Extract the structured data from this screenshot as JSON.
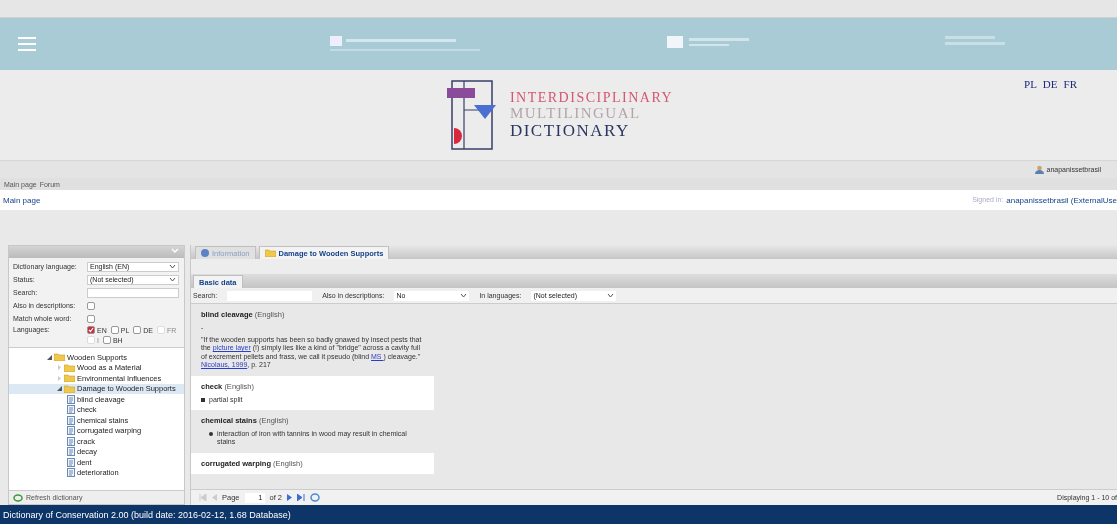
{
  "header": {
    "languages": [
      "PL",
      "DE",
      "FR"
    ],
    "logo_lines": [
      "INTERDISCIPLINARY",
      "MULTILINGUAL",
      "DICTIONARY"
    ],
    "user": "anapanissetbrasil"
  },
  "nav": [
    "Main page",
    "Forum"
  ],
  "breadcrumb": {
    "title": "Main page",
    "signed_label": "Signed in:",
    "signed_user": "anapanissetbrasil (ExternalUse"
  },
  "sidebar": {
    "fields": [
      {
        "kind": "select",
        "label": "Dictionary language:",
        "value": "English (EN)"
      },
      {
        "kind": "select",
        "label": "Status:",
        "value": "(Not selected)"
      },
      {
        "kind": "text",
        "label": "Search:"
      },
      {
        "kind": "checkbox",
        "label": "Also in descriptions:",
        "checked": false
      },
      {
        "kind": "checkbox",
        "label": "Match whole word:",
        "checked": false
      }
    ],
    "languages_label": "Languages:",
    "languages": [
      {
        "label": "EN",
        "checked": true,
        "disabled": false
      },
      {
        "label": "PL",
        "checked": false,
        "disabled": false
      },
      {
        "label": "DE",
        "checked": false,
        "disabled": false
      },
      {
        "label": "FR",
        "checked": false,
        "disabled": true
      },
      {
        "label": "I",
        "checked": false,
        "disabled": true
      },
      {
        "label": "BH",
        "checked": false,
        "disabled": false
      }
    ],
    "tree": [
      {
        "label": "Wooden Supports",
        "kind": "folder",
        "expanded": true,
        "selected": false,
        "children": [
          {
            "label": "Wood as a Material",
            "kind": "folder",
            "expanded": false,
            "selected": false
          },
          {
            "label": "Environmental Influences",
            "kind": "folder",
            "expanded": false,
            "selected": false
          },
          {
            "label": "Damage to Wooden Supports",
            "kind": "folder",
            "expanded": true,
            "selected": true,
            "children": [
              {
                "label": "blind cleavage",
                "kind": "term",
                "selected": false
              },
              {
                "label": "check",
                "kind": "term",
                "selected": false
              },
              {
                "label": "chemical stains",
                "kind": "term",
                "selected": false
              },
              {
                "label": "corrugated warping",
                "kind": "term",
                "selected": false
              },
              {
                "label": "crack",
                "kind": "term",
                "selected": false
              },
              {
                "label": "decay",
                "kind": "term",
                "selected": false
              },
              {
                "label": "dent",
                "kind": "term",
                "selected": false
              },
              {
                "label": "deterioration",
                "kind": "term",
                "selected": false
              }
            ]
          }
        ]
      }
    ],
    "refresh": "Refresh dictionary"
  },
  "tabs": [
    {
      "label": "Information",
      "kind": "info",
      "selected": false
    },
    {
      "label": "Damage to Wooden Supports",
      "kind": "folder",
      "selected": true
    }
  ],
  "subtabs": [
    {
      "label": "Basic data",
      "selected": true
    }
  ],
  "filters": {
    "search_label": "Search:",
    "desc_label": "Also in descriptions:",
    "desc_value": "No",
    "lang_label": "In languages:",
    "lang_value": "(Not selected)"
  },
  "entries": [
    {
      "term": "blind cleavage",
      "lang": "(English)",
      "kind": "quote",
      "dash": "-",
      "quote": [
        {
          "kind": "text",
          "text": "\"If the wooden supports has been so badly gnawed by insect pests that the "
        },
        {
          "kind": "link",
          "text": "picture layer"
        },
        {
          "kind": "text",
          "text": " (!) simply lies like a kind of \"bridge\" across a cavity full of excrement pellets and frass, we call it pseudo (blind "
        },
        {
          "kind": "link",
          "text": "MS "
        },
        {
          "kind": "text",
          "text": ") cleavage.\""
        }
      ],
      "source": "Nicolaus, 1999",
      "page": ", p. 217"
    },
    {
      "term": "check",
      "lang": "(English)",
      "kind": "square",
      "items": [
        "partial split"
      ]
    },
    {
      "term": "chemical stains",
      "lang": "(English)",
      "kind": "bullet",
      "items": [
        "interaction of iron with tannins in wood may result in chemical stains"
      ]
    },
    {
      "term": "corrugated warping",
      "lang": "(English)",
      "kind": "none"
    }
  ],
  "pager": {
    "page_label": "Page",
    "page": "1",
    "of": "of 2",
    "display": "Displaying 1 - 10 of"
  },
  "status_bar": "Dictionary of Conservation 2.00 (build date: 2016-02-12, 1.68 Database)"
}
